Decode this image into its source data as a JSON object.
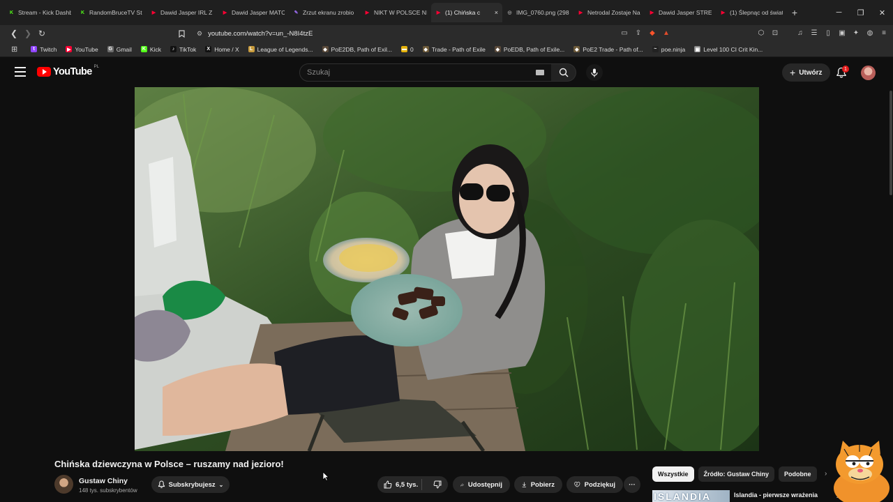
{
  "browser": {
    "tabs": [
      {
        "label": "Stream - Kick Dashb",
        "color": "#53fc18",
        "glyph": "K",
        "active": false
      },
      {
        "label": "RandomBruceTV St",
        "color": "#53fc18",
        "glyph": "K",
        "active": false
      },
      {
        "label": "Dawid Jasper IRL Z",
        "color": "#ff0033",
        "glyph": "▶",
        "active": false
      },
      {
        "label": "Dawid Jasper MATC",
        "color": "#ff0033",
        "glyph": "▶",
        "active": false
      },
      {
        "label": "Zrzut ekranu zrobio",
        "color": "#9b6cf0",
        "glyph": "✎",
        "active": false
      },
      {
        "label": "NIKT W POLSCE NI",
        "color": "#ff0033",
        "glyph": "▶",
        "active": false
      },
      {
        "label": "(1) Chińska c",
        "color": "#ff0033",
        "glyph": "▶",
        "active": true
      },
      {
        "label": "IMG_0760.png (298",
        "color": "#9a9a9a",
        "glyph": "◎",
        "active": false
      },
      {
        "label": "Netrodal Zostaje Na",
        "color": "#ff0033",
        "glyph": "▶",
        "active": false
      },
      {
        "label": "Dawid Jasper STREA",
        "color": "#ff0033",
        "glyph": "▶",
        "active": false
      },
      {
        "label": "(1) Ślepnąc od świat",
        "color": "#ff0033",
        "glyph": "▶",
        "active": false
      }
    ],
    "tab_close": "×",
    "new_tab": "+",
    "url": "youtube.com/watch?v=un_-N8I4tzE",
    "bookmarks": [
      {
        "label": "Twitch",
        "color": "#9146ff",
        "glyph": "t"
      },
      {
        "label": "YouTube",
        "color": "#ff0033",
        "glyph": "▶"
      },
      {
        "label": "Gmail",
        "color": "#6d6d6d",
        "glyph": "G"
      },
      {
        "label": "Kick",
        "color": "#53fc18",
        "glyph": "K"
      },
      {
        "label": "TikTok",
        "color": "#111111",
        "glyph": "♪"
      },
      {
        "label": "Home / X",
        "color": "#111111",
        "glyph": "X"
      },
      {
        "label": "League of Legends...",
        "color": "#c89b3c",
        "glyph": "L"
      },
      {
        "label": "PoE2DB, Path of Exil...",
        "color": "#5a4a3a",
        "glyph": "◆"
      },
      {
        "label": "0",
        "color": "#e5b20a",
        "glyph": "▬"
      },
      {
        "label": "Trade - Path of Exile",
        "color": "#6d5a3a",
        "glyph": "◆"
      },
      {
        "label": "PoEDB, Path of Exile...",
        "color": "#5a4a3a",
        "glyph": "◆"
      },
      {
        "label": "PoE2 Trade - Path of...",
        "color": "#6d5a3a",
        "glyph": "◆"
      },
      {
        "label": "poe.ninja",
        "color": "#222222",
        "glyph": "~"
      },
      {
        "label": "Level 100 CI Crit Kin...",
        "color": "#8a8a8a",
        "glyph": "▣"
      }
    ]
  },
  "youtube": {
    "logo_text": "YouTube",
    "country_code": "PL",
    "search_placeholder": "Szukaj",
    "create_label": "Utwórz",
    "notifications_count": "1"
  },
  "video": {
    "title": "Chińska dziewczyna w Polsce – ruszamy nad jezioro!",
    "channel_name": "Gustaw Chiny",
    "subscribers": "148 tys. subskrybentów",
    "subscribe_label": "Subskrybujesz",
    "likes": "6,5 tys.",
    "share_label": "Udostępnij",
    "download_label": "Pobierz",
    "thanks_label": "Podziękuj",
    "more_label": "···"
  },
  "sidebar": {
    "chips": [
      {
        "label": "Wszystkie",
        "selected": true
      },
      {
        "label": "Źródło: Gustaw Chiny",
        "selected": false
      },
      {
        "label": "Podobne",
        "selected": false
      }
    ],
    "recommended": {
      "thumb_text": "ISLANDIA",
      "title": "Islandia - pierwsze wrażenia"
    }
  },
  "colors": {
    "page_bg": "#0f0f0f",
    "brand_red": "#ff0000",
    "chip_bg": "#272727"
  }
}
